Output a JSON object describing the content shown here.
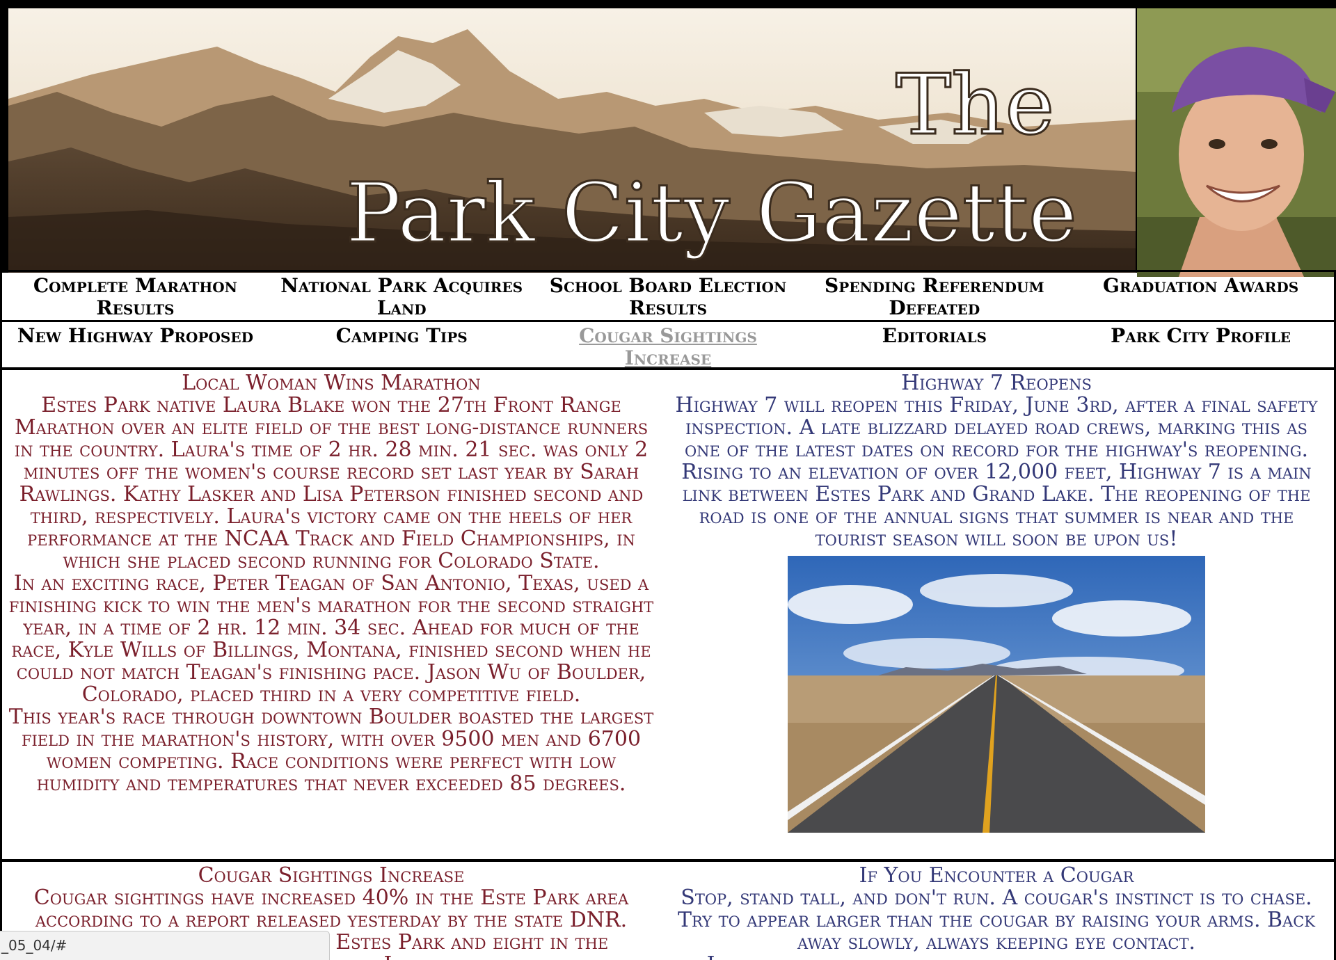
{
  "banner": {
    "title_the": "The",
    "title_main": "Park City Gazette"
  },
  "nav": {
    "row1": [
      {
        "label": "Complete Marathon Results",
        "visited": false
      },
      {
        "label": "National Park Acquires Land",
        "visited": false
      },
      {
        "label": "School Board Election Results",
        "visited": false
      },
      {
        "label": "Spending Referendum Defeated",
        "visited": false
      },
      {
        "label": "Graduation Awards",
        "visited": false
      }
    ],
    "row2": [
      {
        "label": "New Highway Proposed",
        "visited": false
      },
      {
        "label": "Camping Tips",
        "visited": false
      },
      {
        "label": "Cougar Sightings Increase",
        "visited": true
      },
      {
        "label": "Editorials",
        "visited": false
      },
      {
        "label": "Park City Profile",
        "visited": false
      }
    ]
  },
  "articles": {
    "marathon": {
      "title": "Local Woman Wins Marathon",
      "paragraphs": [
        "Estes Park native Laura Blake won the 27th Front Range Marathon over an elite field of the best long-distance runners in the country. Laura's time of 2 hr. 28 min. 21 sec. was only 2 minutes off the women's course record set last year by Sarah Rawlings. Kathy Lasker and Lisa Peterson finished second and third, respectively. Laura's victory came on the heels of her performance at the NCAA Track and Field Championships, in which she placed second running for Colorado State.",
        "In an exciting race, Peter Teagan of San Antonio, Texas, used a finishing kick to win the men's marathon for the second straight year, in a time of 2 hr. 12 min. 34 sec. Ahead for much of the race, Kyle Wills of Billings, Montana, finished second when he could not match Teagan's finishing pace. Jason Wu of Boulder, Colorado, placed third in a very competitive field.",
        "This year's race through downtown Boulder boasted the largest field in the marathon's history, with over 9500 men and 6700 women competing. Race conditions were perfect with low humidity and temperatures that never exceeded 85 degrees."
      ]
    },
    "highway": {
      "title": "Highway 7 Reopens",
      "paragraphs": [
        "Highway 7 will reopen this Friday, June 3rd, after a final safety inspection. A late blizzard delayed road crews, marking this as one of the latest dates on record for the highway's reopening.",
        "Rising to an elevation of over 12,000 feet, Highway 7 is a main link between Estes Park and Grand Lake. The reopening of the road is one of the annual signs that summer is near and the tourist season will soon be upon us!"
      ]
    },
    "cougar": {
      "title": "Cougar Sightings Increase",
      "paragraphs": [
        "Cougar sightings have increased 40% in the Este Park area according to a report released yesterday by the state DNR. There were ten sightings in Estes Park and eight in the vicinities of Grand Lake and"
      ]
    },
    "encounter": {
      "title": "If You Encounter a Cougar",
      "paragraphs": [
        "Stop, stand tall, and don't run. A cougar's instinct is to chase. Try to appear larger than the cougar by raising your arms. Back away slowly, always keeping eye contact.",
        "If the cougar displays aggressive behavior, shout and wave"
      ]
    }
  },
  "status_bar": {
    "url": "_05_04/#"
  },
  "colors": {
    "maroon": "#7a1f2b",
    "navy": "#333877",
    "visited_link": "#999999",
    "border": "#000000"
  }
}
